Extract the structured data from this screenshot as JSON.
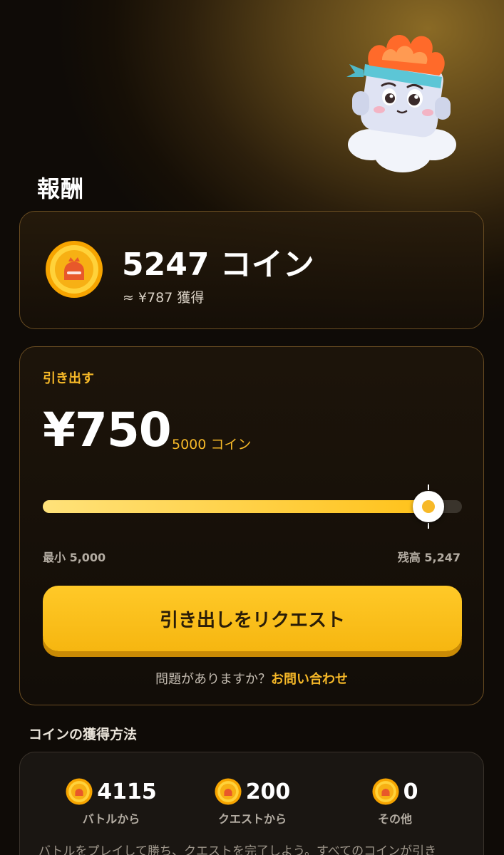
{
  "header": {
    "title": "報酬"
  },
  "balance": {
    "amount_label": "5247 コイン",
    "approx_label": "≈ ¥787 獲得"
  },
  "withdraw": {
    "label": "引き出す",
    "amount": "¥750",
    "coins_label": "5000 コイン",
    "slider": {
      "fraction": 0.92
    },
    "min_label": "最小 5,000",
    "max_label": "残高 5,247",
    "button_label": "引き出しをリクエスト",
    "help_text": "問題がありますか？",
    "help_link": "お問い合わせ"
  },
  "earn": {
    "section_title": "コインの獲得方法",
    "stats": [
      {
        "value": "4115",
        "label": "バトルから"
      },
      {
        "value": "200",
        "label": "クエストから"
      },
      {
        "value": "0",
        "label": "その他"
      }
    ],
    "description": "バトルをプレイして勝ち、クエストを完了しよう。すべてのコインが引き"
  },
  "colors": {
    "accent": "#f7b928",
    "button": "#ffc21a",
    "background": "#0f0b07"
  },
  "icons": {
    "coin": "coin-icon",
    "mascot": "mascot-illustration"
  }
}
